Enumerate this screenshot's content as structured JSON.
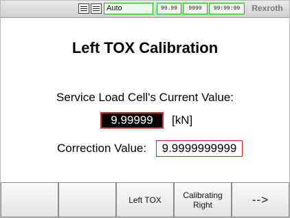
{
  "statusbar": {
    "mode": "Auto",
    "fields": [
      "99.99",
      "9999",
      "99:99:99"
    ],
    "brand": "Rexroth"
  },
  "screen": {
    "title": "Left TOX Calibration",
    "load_cell_label": "Service Load Cell's Current Value:",
    "load_cell_value": "9.99999",
    "load_cell_unit": "[kN]",
    "correction_label": "Correction Value:",
    "correction_value": "9.9999999999"
  },
  "softkeys": [
    {
      "label": ""
    },
    {
      "label": ""
    },
    {
      "label": "Left TOX"
    },
    {
      "label": "Calibrating Right"
    },
    {
      "label": "-->"
    }
  ],
  "icons": {
    "menu_1": "list-menu-icon",
    "menu_2": "list-menu-icon"
  },
  "colors": {
    "mode_border": "#1fb21f",
    "value_highlight_border": "#e02424"
  }
}
